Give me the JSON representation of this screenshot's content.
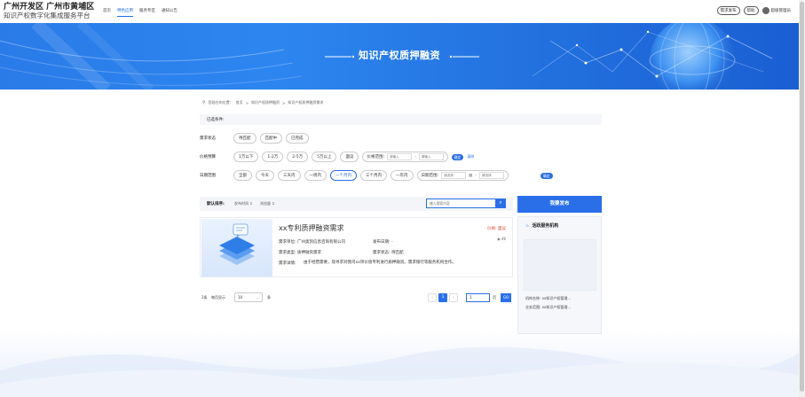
{
  "brand": {
    "title": "广州开发区 广州市黄埔区",
    "subtitle": "知识产权数字化集成服务平台"
  },
  "nav": {
    "items": [
      "首页",
      "特色应用",
      "服务专区",
      "通知公告"
    ],
    "active_index": 1
  },
  "header_right": {
    "publish": "需求发布",
    "help": "帮助",
    "admin": "超级管理员"
  },
  "banner": {
    "title": "知识产权质押融资"
  },
  "breadcrumb": {
    "prefix": "您现在的位置：",
    "items": [
      "首页",
      "知识产权质押融资",
      "知识产权质押融资需求"
    ]
  },
  "conditions": {
    "label": "已选条件:"
  },
  "filters": {
    "status": {
      "label": "需求状态",
      "options": [
        "待匹配",
        "匹配中",
        "已完成"
      ]
    },
    "price": {
      "label": "价格预算",
      "options": [
        "1万以下",
        "1-2万",
        "2-5万",
        "5万以上",
        "面议"
      ],
      "range_label": "价格范围:",
      "min_placeholder": "请输入",
      "max_placeholder": "请输入",
      "confirm": "确定",
      "clear": "清除"
    },
    "date": {
      "label": "日期范围",
      "options": [
        "全部",
        "今天",
        "三天内",
        "一周内",
        "一个月内",
        "三个月内",
        "一年内"
      ],
      "active_index": 4,
      "range_label": "日期范围:",
      "start_placeholder": "请选择",
      "end_placeholder": "请选择",
      "confirm": "确定"
    }
  },
  "sort": {
    "label": "默认排序:",
    "by_time": "发布时间 ⇕",
    "by_views": "浏览量 ⇕",
    "search_placeholder": "输入搜索内容"
  },
  "results": [
    {
      "title": "xx专利质押融资需求",
      "price_label": "价格: 面议",
      "views": "46",
      "unit_label": "需求单位: 广州奥凯信息咨询有限公司",
      "publish_date_label": "发布日期: -",
      "type_label": "需求类型: 质押融资需求",
      "status_label": "需求状态: 待匹配",
      "detail_label": "需求详情:",
      "detail_value": "由于经营需要，现寻求对我司xx项价值专利进行质押融资。需求银行等服务机构合作。"
    }
  ],
  "pagination": {
    "total": "1条",
    "per_page_label": "每页显示",
    "per_page_value": "10",
    "per_page_unit": "条",
    "current_page": "1",
    "jump_value": "1",
    "page_unit": "页",
    "go": "GO"
  },
  "sidebar": {
    "publish_button": "我要发布",
    "org_title": "活跃服务机构",
    "org_name": "机构名称: xx知识产权管理...",
    "org_scope": "业务范围: xx知识产权管理..."
  },
  "colors": {
    "primary": "#2a6fe8",
    "price": "#e24a2b",
    "banner": "#2d86f0"
  }
}
